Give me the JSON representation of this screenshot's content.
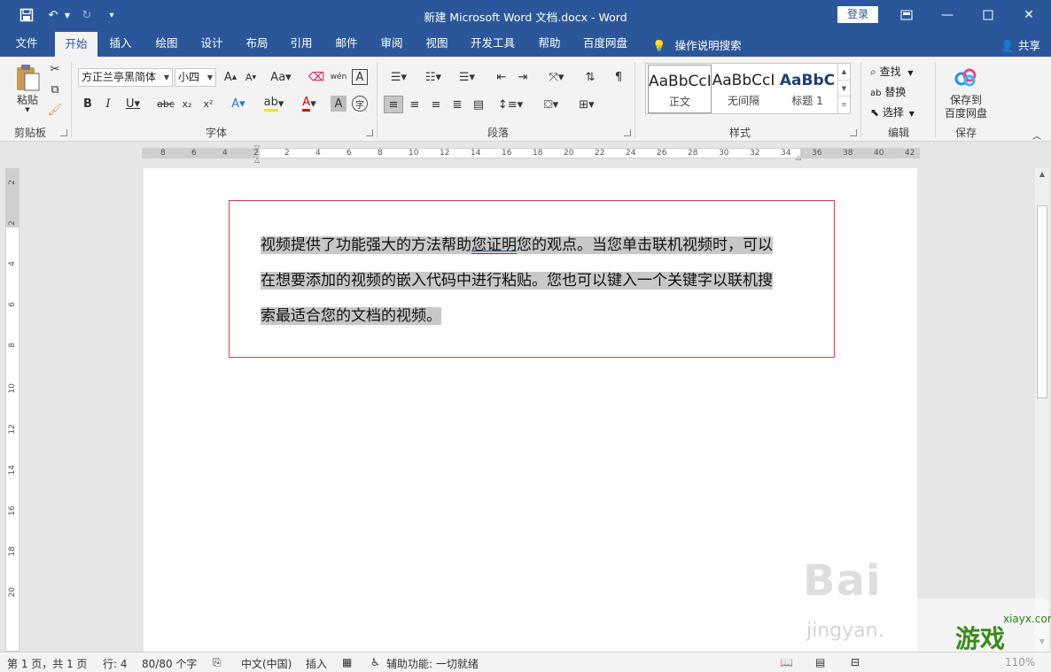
{
  "titlebar": {
    "doc_title": "新建 Microsoft Word 文档.docx  -  Word",
    "login": "登录"
  },
  "tabs": [
    "文件",
    "开始",
    "插入",
    "绘图",
    "设计",
    "布局",
    "引用",
    "邮件",
    "审阅",
    "视图",
    "开发工具",
    "帮助",
    "百度网盘"
  ],
  "tell_me": "操作说明搜索",
  "share": "共享",
  "ribbon": {
    "clipboard": {
      "paste": "粘贴",
      "label": "剪贴板"
    },
    "font": {
      "name": "方正兰亭黑简体",
      "size": "小四",
      "label": "字体"
    },
    "paragraph": {
      "label": "段落"
    },
    "styles": {
      "label": "样式",
      "items": [
        {
          "sample": "AaBbCcI",
          "name": "正文"
        },
        {
          "sample": "AaBbCcI",
          "name": "无间隔"
        },
        {
          "sample": "AaBbC",
          "name": "标题 1"
        }
      ]
    },
    "editing": {
      "find": "查找",
      "replace": "替换",
      "select": "选择",
      "label": "编辑"
    },
    "save": {
      "line1": "保存到",
      "line2": "百度网盘",
      "label": "保存"
    }
  },
  "ruler": {
    "labels": [
      "8",
      "6",
      "4",
      "2",
      "2",
      "4",
      "6",
      "8",
      "10",
      "12",
      "14",
      "16",
      "18",
      "20",
      "22",
      "24",
      "26",
      "28",
      "30",
      "32",
      "34",
      "36",
      "38",
      "40",
      "42"
    ]
  },
  "vruler": {
    "labels": [
      "2",
      "2",
      "4",
      "6",
      "8",
      "10",
      "12",
      "14",
      "16",
      "18",
      "20"
    ]
  },
  "document": {
    "line1_pre": "视频提供了功能强大的方法帮助",
    "line1_err": "您证明",
    "line1_post": "您的观点。当您单击联机视频时，可以",
    "line2": "在想要添加的视频的嵌入代码中进行粘贴。您也可以键入一个关键字以联机搜",
    "line3": "索最适合您的文档的视频。"
  },
  "status": {
    "page": "第 1 页，共 1 页",
    "line": "行: 4",
    "words": "80/80 个字",
    "lang": "中文(中国)",
    "mode": "插入",
    "accessibility": "辅助功能: 一切就绪",
    "zoom": "110%"
  },
  "watermark": {
    "baidu": "Bai",
    "jingyan": "jingyan.",
    "site_text": "游戏",
    "site_url": "xiayx.com"
  },
  "colors": {
    "brand": "#2b579a",
    "textbox_border": "#d9414b",
    "selection": "#c8c8c8"
  }
}
